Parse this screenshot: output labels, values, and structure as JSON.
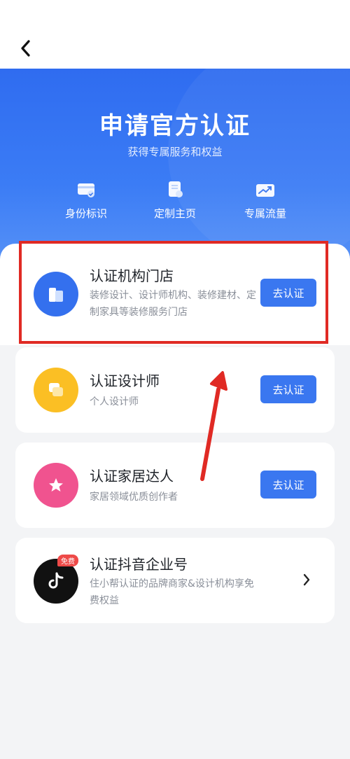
{
  "hero": {
    "title": "申请官方认证",
    "subtitle": "获得专属服务和权益",
    "benefits": [
      {
        "label": "身份标识",
        "icon": "id-card-icon"
      },
      {
        "label": "定制主页",
        "icon": "custom-page-icon"
      },
      {
        "label": "专属流量",
        "icon": "traffic-trend-icon"
      }
    ]
  },
  "options": [
    {
      "title": "认证机构门店",
      "desc": "装修设计、设计师机构、装修建材、定制家具等装修服务门店",
      "action": "去认证",
      "icon": "store-icon",
      "color": "#3470ee"
    },
    {
      "title": "认证设计师",
      "desc": "个人设计师",
      "action": "去认证",
      "icon": "designer-icon",
      "color": "#fbbf24"
    },
    {
      "title": "认证家居达人",
      "desc": "家居领域优质创作者",
      "action": "去认证",
      "icon": "star-icon",
      "color": "#f0538f"
    },
    {
      "title": "认证抖音企业号",
      "desc": "住小帮认证的品牌商家&设计机构享免费权益",
      "badge": "免费",
      "icon": "douyin-icon",
      "color": "#111111"
    }
  ],
  "colors": {
    "accent": "#3a77f0",
    "highlight": "#e02a24"
  }
}
